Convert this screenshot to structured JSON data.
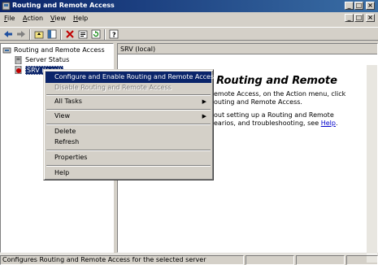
{
  "window": {
    "title": "Routing and Remote Access",
    "controls": {
      "minimize": "_",
      "maximize": "□",
      "close": "×"
    }
  },
  "menubar": {
    "items": [
      {
        "label": "File",
        "accel": "F",
        "rest": "ile"
      },
      {
        "label": "Action",
        "accel": "A",
        "rest": "ction"
      },
      {
        "label": "View",
        "accel": "V",
        "rest": "iew"
      },
      {
        "label": "Help",
        "accel": "H",
        "rest": "elp"
      }
    ]
  },
  "toolbar": {
    "icons": [
      "back-icon",
      "forward-icon",
      "up-icon",
      "show-tree-icon",
      "delete-icon",
      "properties-icon",
      "refresh-icon",
      "help-icon"
    ]
  },
  "tree": {
    "root": "Routing and Remote Access",
    "items": [
      "Server Status",
      "SRV (local)"
    ]
  },
  "right_pane": {
    "header": "SRV (local)",
    "heading": "Configure the Routing and Remote",
    "lines": [
      "emote Access, on the Action menu, click",
      "outing and Remote Access.",
      "out setting up a Routing and Remote",
      "earios, and troubleshooting, see"
    ],
    "help_link": "Help",
    "help_suffix": "."
  },
  "context_menu": {
    "items": [
      {
        "label": "Configure and Enable Routing and Remote Access",
        "state": "selected"
      },
      {
        "label": "Disable Routing and Remote Access",
        "state": "disabled"
      },
      {
        "label": "All Tasks",
        "state": "normal",
        "submenu": true
      },
      {
        "label": "View",
        "state": "normal",
        "submenu": true
      },
      {
        "label": "Delete",
        "state": "normal"
      },
      {
        "label": "Refresh",
        "state": "normal"
      },
      {
        "label": "Properties",
        "state": "normal"
      },
      {
        "label": "Help",
        "state": "normal"
      }
    ],
    "submenu_arrow": "▶"
  },
  "statusbar": {
    "text": "Configures Routing and Remote Access for the selected server"
  },
  "colors": {
    "title_active": "#0a246a",
    "title_gradient_end": "#3a6ea5",
    "face": "#d4d0c8",
    "selection": "#0a246a",
    "link": "#0000cc"
  }
}
